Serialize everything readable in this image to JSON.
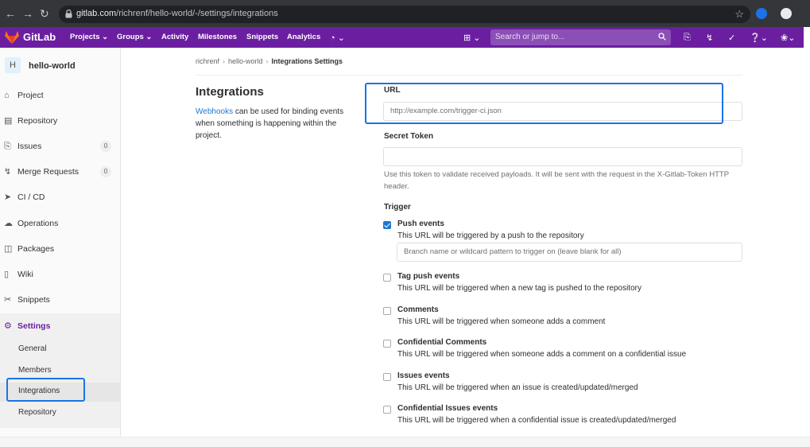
{
  "browser": {
    "url_host": "gitlab.com",
    "url_path": "/richrenf/hello-world/-/settings/integrations"
  },
  "navbar": {
    "brand": "GitLab",
    "menu": [
      "Projects",
      "Groups",
      "Activity",
      "Milestones",
      "Snippets",
      "Analytics"
    ],
    "search_placeholder": "Search or jump to..."
  },
  "sidebar": {
    "avatar_letter": "H",
    "project_name": "hello-world",
    "items": [
      {
        "label": "Project",
        "icon": "home-icon"
      },
      {
        "label": "Repository",
        "icon": "repository-icon"
      },
      {
        "label": "Issues",
        "icon": "issues-icon",
        "count": "0"
      },
      {
        "label": "Merge Requests",
        "icon": "merge-request-icon",
        "count": "0"
      },
      {
        "label": "CI / CD",
        "icon": "rocket-icon"
      },
      {
        "label": "Operations",
        "icon": "cloud-icon"
      },
      {
        "label": "Packages",
        "icon": "package-icon"
      },
      {
        "label": "Wiki",
        "icon": "book-icon"
      },
      {
        "label": "Snippets",
        "icon": "scissors-icon"
      },
      {
        "label": "Settings",
        "icon": "gear-icon"
      }
    ],
    "settings_sub": [
      "General",
      "Members",
      "Integrations",
      "Repository"
    ]
  },
  "breadcrumb": [
    "richrenf",
    "hello-world",
    "Integrations Settings"
  ],
  "page": {
    "title": "Integrations",
    "desc_link": "Webhooks",
    "desc_rest": " can be used for binding events when something is happening within the project."
  },
  "form": {
    "url_label": "URL",
    "url_placeholder": "http://example.com/trigger-ci.json",
    "token_label": "Secret Token",
    "token_help": "Use this token to validate received payloads. It will be sent with the request in the X-Gitlab-Token HTTP header.",
    "trigger_label": "Trigger",
    "branch_placeholder": "Branch name or wildcard pattern to trigger on (leave blank for all)",
    "events": [
      {
        "title": "Push events",
        "desc": "This URL will be triggered by a push to the repository",
        "checked": true
      },
      {
        "title": "Tag push events",
        "desc": "This URL will be triggered when a new tag is pushed to the repository",
        "checked": false
      },
      {
        "title": "Comments",
        "desc": "This URL will be triggered when someone adds a comment",
        "checked": false
      },
      {
        "title": "Confidential Comments",
        "desc": "This URL will be triggered when someone adds a comment on a confidential issue",
        "checked": false
      },
      {
        "title": "Issues events",
        "desc": "This URL will be triggered when an issue is created/updated/merged",
        "checked": false
      },
      {
        "title": "Confidential Issues events",
        "desc": "This URL will be triggered when a confidential issue is created/updated/merged",
        "checked": false
      }
    ]
  },
  "colors": {
    "navbar": "#6b1fa0",
    "link": "#1f78d1",
    "highlight": "#1a73e8"
  }
}
